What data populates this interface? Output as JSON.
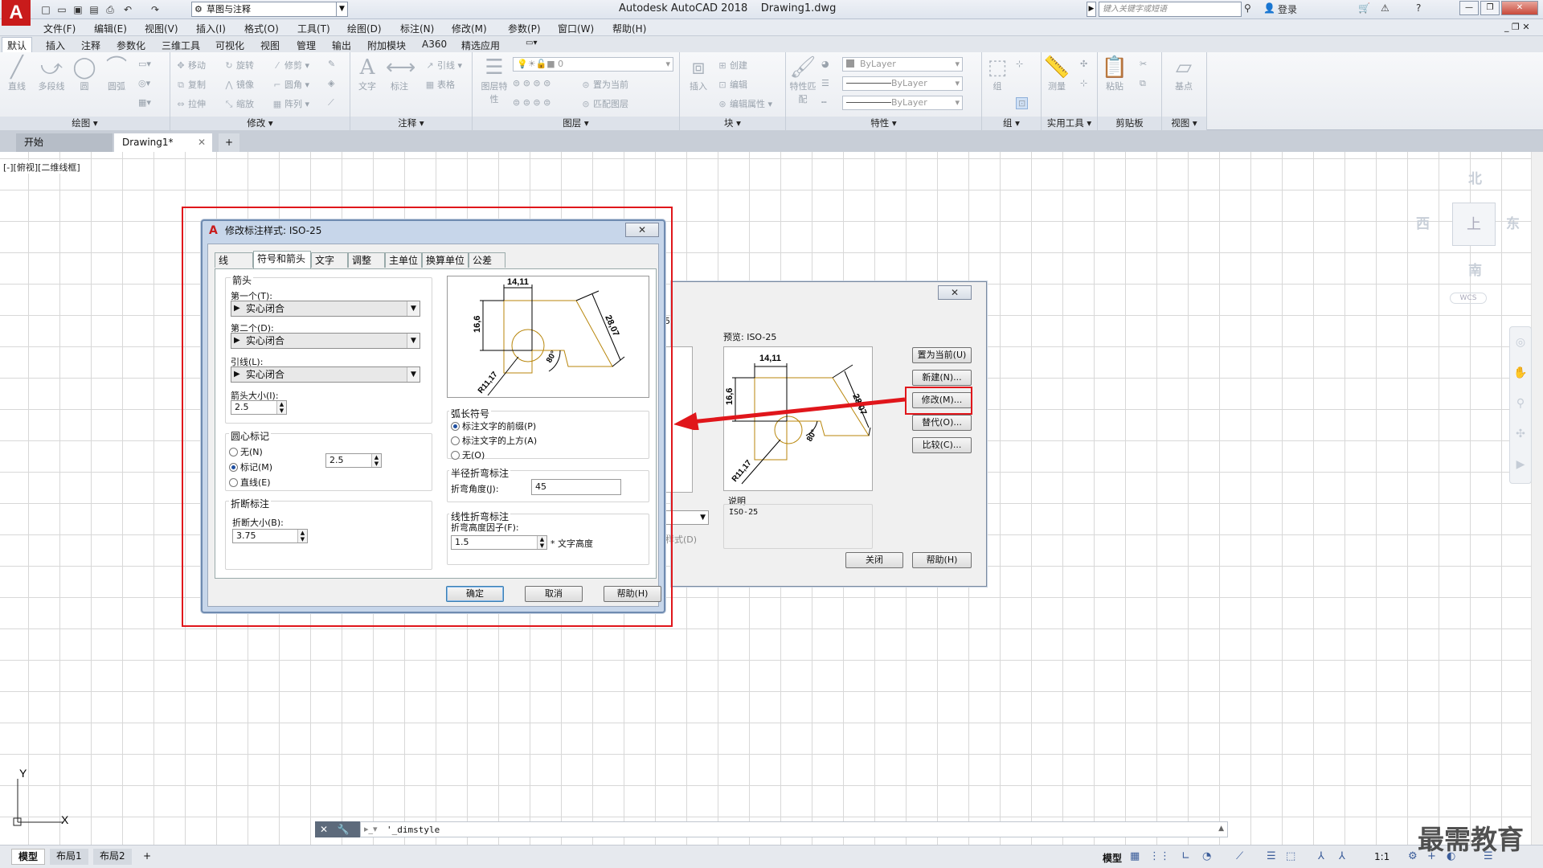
{
  "titlebar": {
    "logo": "A",
    "workspace": "草图与注释",
    "app_title": "Autodesk AutoCAD 2018",
    "doc_title": "Drawing1.dwg",
    "search_placeholder": "键入关键字或短语",
    "login": "登录"
  },
  "menu": [
    "文件(F)",
    "编辑(E)",
    "视图(V)",
    "插入(I)",
    "格式(O)",
    "工具(T)",
    "绘图(D)",
    "标注(N)",
    "修改(M)",
    "参数(P)",
    "窗口(W)",
    "帮助(H)"
  ],
  "ribbon_tabs": [
    "默认",
    "插入",
    "注释",
    "参数化",
    "三维工具",
    "可视化",
    "视图",
    "管理",
    "输出",
    "附加模块",
    "A360",
    "精选应用"
  ],
  "ribbon": {
    "draw": {
      "title": "绘图",
      "line": "直线",
      "polyline": "多段线",
      "circle": "圆",
      "arc": "圆弧"
    },
    "modify": {
      "title": "修改",
      "move": "移动",
      "rotate": "旋转",
      "trim": "修剪",
      "copy": "复制",
      "mirror": "镜像",
      "fillet": "圆角",
      "stretch": "拉伸",
      "scale": "缩放",
      "array": "阵列"
    },
    "annotation": {
      "title": "注释",
      "text": "文字",
      "dimension": "标注",
      "leader": "引线",
      "table": "表格"
    },
    "layers": {
      "title": "图层",
      "props": "图层特性",
      "layer_value": "0",
      "set_current": "置为当前",
      "match": "匹配图层"
    },
    "block": {
      "title": "块",
      "insert": "插入",
      "create": "创建",
      "edit": "编辑",
      "edit_attr": "编辑属性"
    },
    "properties": {
      "title": "特性",
      "match": "特性匹配",
      "color": "ByLayer",
      "linetype": "ByLayer",
      "lineweight": "ByLayer"
    },
    "groups": {
      "title": "组",
      "group": "组"
    },
    "utilities": {
      "title": "实用工具",
      "measure": "测量"
    },
    "clipboard": {
      "title": "剪贴板",
      "paste": "粘贴"
    },
    "view": {
      "title": "视图",
      "base": "基点"
    }
  },
  "doc_tabs": {
    "start": "开始",
    "drawing": "Drawing1*"
  },
  "viewport_label": "[-][俯视][二维线框]",
  "viewcube": {
    "north": "北",
    "south": "南",
    "east": "东",
    "west": "西",
    "face": "上",
    "wcs": "WCS"
  },
  "dimstyle_manager": {
    "partial_label": "5",
    "preview_label": "预览: ISO-25",
    "set_current": "置为当前(U)",
    "new": "新建(N)...",
    "modify": "修改(M)...",
    "override": "替代(O)...",
    "compare": "比较(C)...",
    "desc_label": "说明",
    "desc_value": "ISO-25",
    "list_label": "样式(D)",
    "close": "关闭",
    "help": "帮助(H)",
    "preview_dims": {
      "top": "14,11",
      "left": "16,6",
      "diag": "28,07",
      "angle": "80°",
      "radius": "R11,17"
    }
  },
  "modify_dialog": {
    "title": "修改标注样式: ISO-25",
    "tabs": [
      "线",
      "符号和箭头",
      "文字",
      "调整",
      "主单位",
      "换算单位",
      "公差"
    ],
    "arrows": {
      "group": "箭头",
      "first_label": "第一个(T):",
      "first_value": "实心闭合",
      "second_label": "第二个(D):",
      "second_value": "实心闭合",
      "leader_label": "引线(L):",
      "leader_value": "实心闭合",
      "size_label": "箭头大小(I):",
      "size_value": "2.5"
    },
    "center_marks": {
      "group": "圆心标记",
      "none": "无(N)",
      "mark": "标记(M)",
      "line": "直线(E)",
      "value": "2.5"
    },
    "break": {
      "group": "折断标注",
      "size_label": "折断大小(B):",
      "size_value": "3.75"
    },
    "arc_length": {
      "group": "弧长符号",
      "before": "标注文字的前缀(P)",
      "above": "标注文字的上方(A)",
      "none": "无(O)"
    },
    "radius_jog": {
      "group": "半径折弯标注",
      "angle_label": "折弯角度(J):",
      "angle_value": "45"
    },
    "linear_jog": {
      "group": "线性折弯标注",
      "factor_label": "折弯高度因子(F):",
      "factor_value": "1.5",
      "suffix": "* 文字高度"
    },
    "ok": "确定",
    "cancel": "取消",
    "help": "帮助(H)",
    "preview_dims": {
      "top": "14,11",
      "left": "16,6",
      "diag": "28,07",
      "angle": "80°",
      "radius": "R11,17"
    }
  },
  "command": {
    "text": "'_dimstyle"
  },
  "ucs": {
    "x": "X",
    "y": "Y"
  },
  "layout_tabs": {
    "model": "模型",
    "layout1": "布局1",
    "layout2": "布局2"
  },
  "status": {
    "model": "模型",
    "scale": "1:1"
  },
  "watermark": "最需教育",
  "colors": {
    "accent_red": "#e0161b",
    "brand": "#c91b1b",
    "preview_geom": "#b8860b"
  }
}
